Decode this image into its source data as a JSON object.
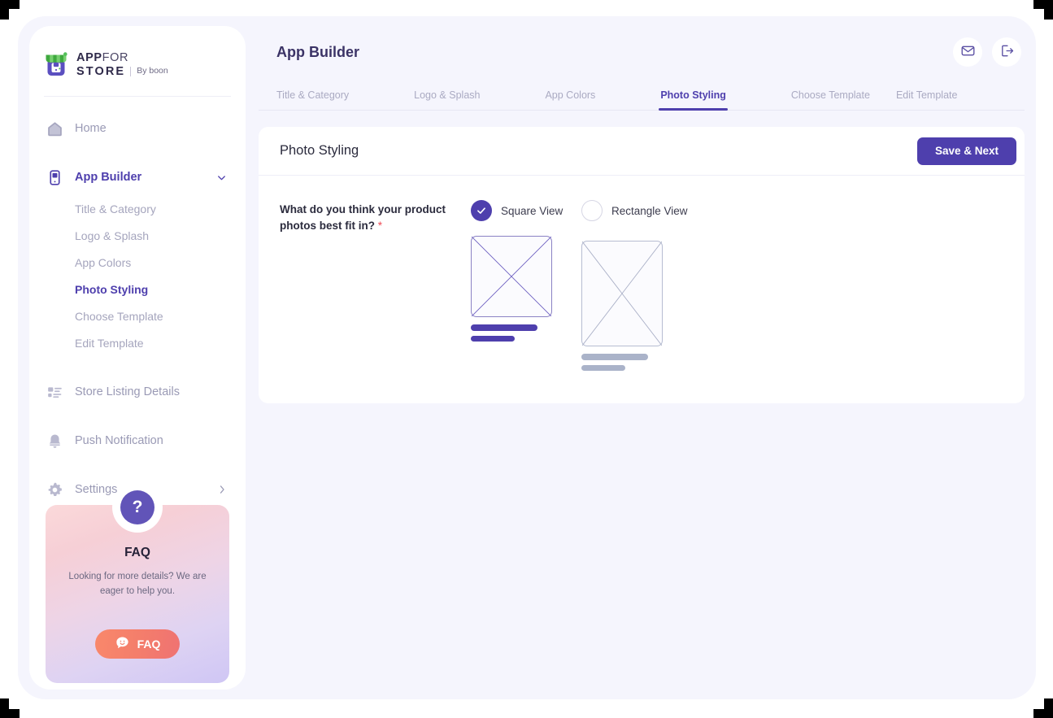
{
  "brand": {
    "line1_bold": "APP",
    "line1_light": "FOR",
    "line2": "STORE",
    "byline": "By boon",
    "logo_icon": "storefront-icon"
  },
  "sidebar": {
    "nav": [
      {
        "label": "Home",
        "icon": "home-icon",
        "active": false
      },
      {
        "label": "App Builder",
        "icon": "mobile-app-icon",
        "active": true,
        "chevron": "chevron-down-icon"
      },
      {
        "label": "Store Listing Details",
        "icon": "list-details-icon",
        "active": false
      },
      {
        "label": "Push Notification",
        "icon": "bell-icon",
        "active": false
      },
      {
        "label": "Settings",
        "icon": "gear-icon",
        "active": false,
        "chevron": "chevron-right-icon"
      }
    ],
    "subnav": [
      {
        "label": "Title & Category",
        "active": false
      },
      {
        "label": "Logo & Splash",
        "active": false
      },
      {
        "label": "App Colors",
        "active": false
      },
      {
        "label": "Photo Styling",
        "active": true
      },
      {
        "label": "Choose Template",
        "active": false
      },
      {
        "label": "Edit Template",
        "active": false
      }
    ],
    "faq": {
      "badge_glyph": "?",
      "title": "FAQ",
      "description": "Looking for more details? We are eager to help you.",
      "button_label": "FAQ",
      "button_icon": "chat-smile-icon"
    }
  },
  "header": {
    "title": "App Builder",
    "mail_icon": "envelope-icon",
    "logout_icon": "logout-icon"
  },
  "tabs": [
    {
      "label": "Title & Category",
      "active": false
    },
    {
      "label": "Logo & Splash",
      "active": false
    },
    {
      "label": "App Colors",
      "active": false
    },
    {
      "label": "Photo Styling",
      "active": true
    },
    {
      "label": "Choose Template",
      "active": false
    },
    {
      "label": "Edit Template",
      "active": false
    }
  ],
  "card": {
    "title": "Photo Styling",
    "save_label": "Save & Next",
    "question": "What do you think your product photos best fit in?",
    "required_mark": "*",
    "options": [
      {
        "label": "Square View",
        "selected": true,
        "preview": "square-placeholder"
      },
      {
        "label": "Rectangle View",
        "selected": false,
        "preview": "rectangle-placeholder"
      }
    ]
  },
  "colors": {
    "accent": "#4e3fad",
    "accent_soft": "#6154b8",
    "page_bg": "#f5f5fd",
    "muted_text": "#9a9ab5",
    "required_red": "#ef4a55",
    "faq_button": "#f4806b",
    "placeholder_gray": "#aab3c9"
  }
}
